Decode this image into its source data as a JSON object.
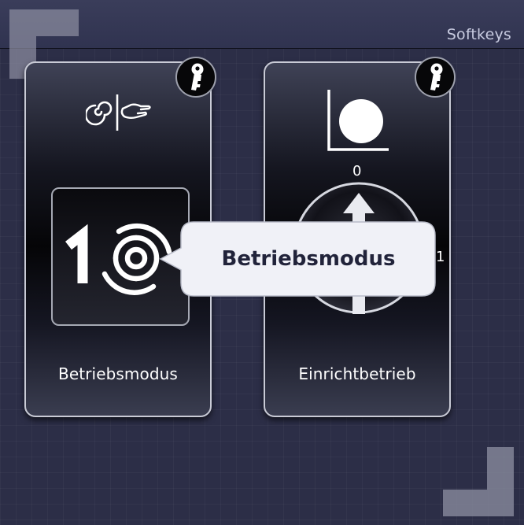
{
  "header": {
    "title": "Softkeys"
  },
  "softkeys": [
    {
      "label": "Betriebsmodus",
      "top_icon": "auto-manual-switch-icon",
      "main_icon": "mode-one-swirl-icon",
      "locked": true
    },
    {
      "label": "Einrichtbetrieb",
      "top_icon": "chart-dot-icon",
      "main_icon": "dial-arrow-icon",
      "dial": {
        "top_value": "0",
        "right_value": "1"
      },
      "locked": true
    }
  ],
  "tooltip": {
    "text": "Betriebsmodus"
  },
  "colors": {
    "background": "#2c2e47",
    "header": "#363954",
    "card_border": "#c9cbd6",
    "tooltip_bg": "#f0f1f7",
    "tooltip_text": "#21233a"
  }
}
